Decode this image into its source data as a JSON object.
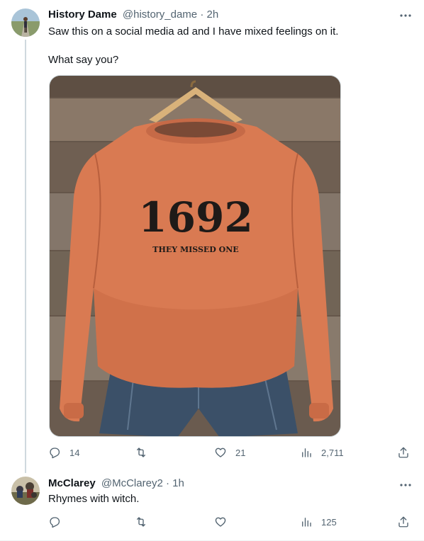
{
  "tweets": [
    {
      "display_name": "History Dame",
      "handle": "@history_dame",
      "separator": "·",
      "time": "2h",
      "text_line1": "Saw this on a social media ad and I have mixed feelings on it.",
      "text_line2": "What say you?",
      "media": {
        "print_big": "1692",
        "print_small": "THEY MISSED ONE",
        "sweatshirt_color": "#d97a52"
      },
      "stats": {
        "replies": "14",
        "retweets": "",
        "likes": "21",
        "views": "2,711"
      }
    },
    {
      "display_name": "McClarey",
      "handle": "@McClarey2",
      "separator": "·",
      "time": "1h",
      "text": "Rhymes with witch.",
      "stats": {
        "replies": "",
        "retweets": "",
        "likes": "",
        "views": "125"
      }
    }
  ],
  "icons": [
    "reply-icon",
    "retweet-icon",
    "like-icon",
    "views-icon",
    "share-icon",
    "more-icon"
  ],
  "colors": {
    "text_primary": "#0f1419",
    "text_secondary": "#536471",
    "thread_line": "#cfd9de"
  }
}
